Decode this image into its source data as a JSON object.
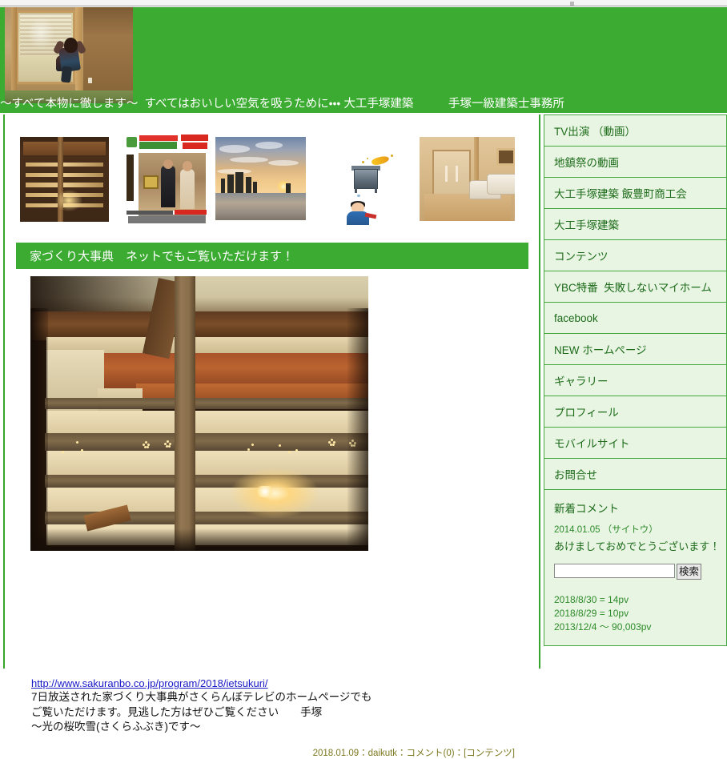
{
  "site": {
    "tagline": "～すべて本物に徹します～  すべてはおいしい空気を吸うために・・・ 大工手塚建築　　　手塚一級建築士事務所",
    "brand_green": "#3cab31",
    "panel_green": "#e7f5e2",
    "link_blue": "#1919c8"
  },
  "header": {
    "photo_name": "japanese-room-photo"
  },
  "thumbnails": [
    {
      "name": "ranma-transom-thumb",
      "caption": "欄間（らんま）"
    },
    {
      "name": "tv-program-flyer-thumb",
      "caption": "さくらんぼテレビ 放送決定！ぜひご覧く"
    },
    {
      "name": "winter-sunset-thumb",
      "caption": "冬の夕日"
    },
    {
      "name": "stove-illustration-thumb",
      "caption": "ストーブのイラスト"
    },
    {
      "name": "bedroom-interior-thumb",
      "caption": "寝室"
    }
  ],
  "post": {
    "headline": "家づくり大事典　ネットでもご覧いただけます！",
    "photo_name": "ranma-transom-main-photo",
    "link": "http://www.sakuranbo.co.jp/program/2018/ietsukuri/",
    "body": "7日放送された家づくり大事典がさくらんぼテレビのホームページでも\nご覧いただけます。見逃した方はぜひご覧ください　　手塚\n～光の桜吹雪(さくらふぶき)です～",
    "meta": "2018.01.09：daikutk：コメント(0)：[コンテンツ]"
  },
  "sidebar": {
    "items": [
      {
        "label": "TV出演 （動画）",
        "name": "sidebar-item-tv-appearance"
      },
      {
        "label": "地鎮祭の動画",
        "name": "sidebar-item-jichinsai-video"
      },
      {
        "label": "大工手塚建築 飯豊町商工会",
        "name": "sidebar-item-iidemachi-shokokai"
      },
      {
        "label": "大工手塚建築",
        "name": "sidebar-item-daiku-tezuka"
      },
      {
        "label": "コンテンツ",
        "name": "sidebar-item-contents"
      },
      {
        "label": "YBC特番  失敗しないマイホーム",
        "name": "sidebar-item-ybc-special"
      },
      {
        "label": "facebook",
        "name": "sidebar-item-facebook"
      },
      {
        "label": "NEW ホームページ",
        "name": "sidebar-item-new-homepage"
      },
      {
        "label": "ギャラリー",
        "name": "sidebar-item-gallery"
      },
      {
        "label": "プロフィール",
        "name": "sidebar-item-profile"
      },
      {
        "label": "モバイルサイト",
        "name": "sidebar-item-mobile-site"
      },
      {
        "label": "お問合せ",
        "name": "sidebar-item-contact"
      }
    ],
    "comments": {
      "title": "新着コメント",
      "date": "2014.01.05 （サイトウ）",
      "text": "あけましておめでとうございます！"
    },
    "search": {
      "value": "",
      "placeholder": "",
      "button_label": "検索"
    },
    "stats": [
      "2018/8/30 = 14pv",
      "2018/8/29 = 10pv",
      "2013/12/4 ～ 90,003pv"
    ]
  }
}
